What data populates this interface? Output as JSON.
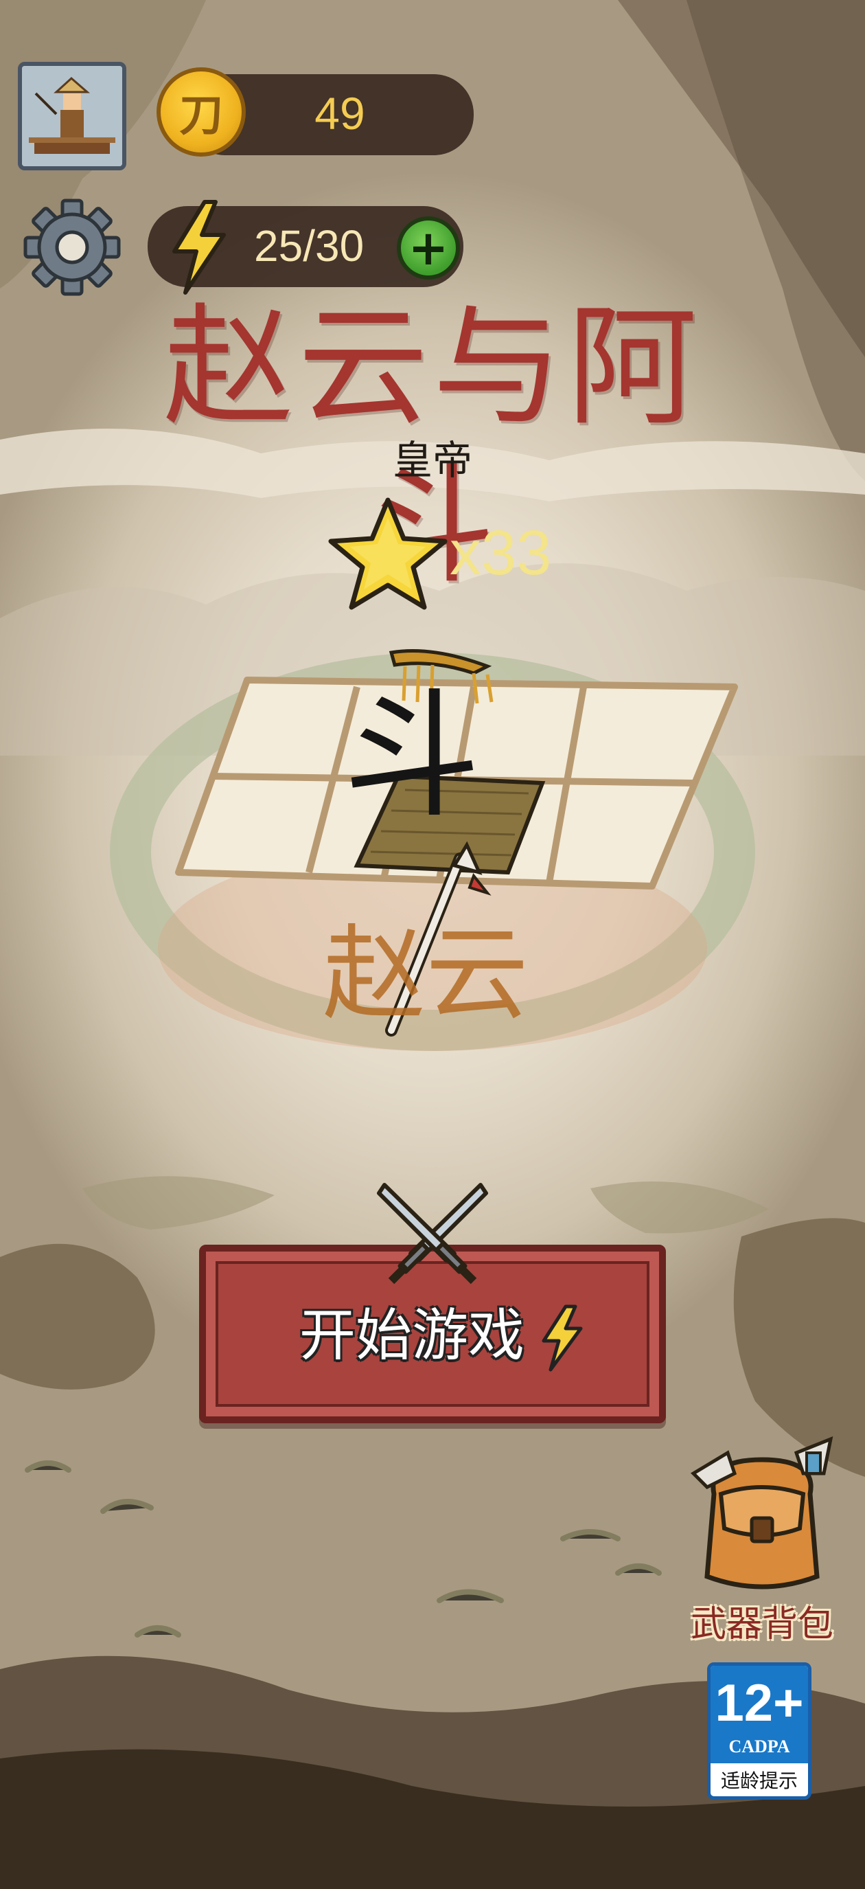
{
  "hud": {
    "coins": "49",
    "coin_symbol": "刀",
    "energy": "25/30",
    "energy_plus": "+"
  },
  "level": {
    "title": "赵云与阿斗",
    "subtitle": "皇帝",
    "stars": "x33"
  },
  "board": {
    "top_glyph": "斗",
    "bottom_glyph": "赵云"
  },
  "actions": {
    "start_label": "开始游戏",
    "backpack_label": "武器背包"
  },
  "age_rating": {
    "number": "12+",
    "org": "CADPA",
    "note": "适龄提示"
  },
  "colors": {
    "title_red": "#a5352f",
    "coin_gold": "#f5cc52",
    "button_red": "#a8433e",
    "plus_green": "#3f9e2c",
    "badge_blue": "#1a78c8"
  }
}
